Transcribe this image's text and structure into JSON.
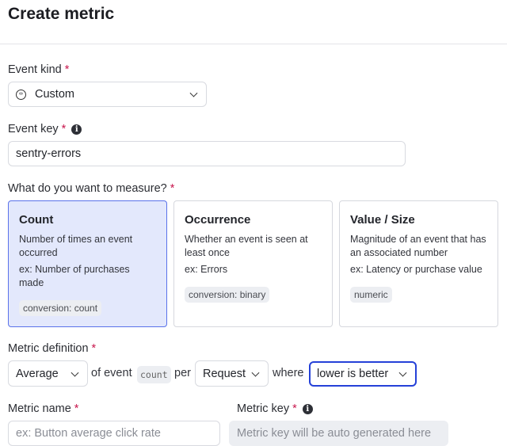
{
  "title": "Create metric",
  "event_kind": {
    "label": "Event kind",
    "value": "Custom",
    "icon": "code-circle-icon"
  },
  "event_key": {
    "label": "Event key",
    "value": "sentry-errors"
  },
  "measure": {
    "label": "What do you want to measure?",
    "options": [
      {
        "title": "Count",
        "desc": "Number of times an event occurred",
        "example": "ex: Number of purchases made",
        "tag": "conversion: count",
        "selected": true
      },
      {
        "title": "Occurrence",
        "desc": "Whether an event is seen at least once",
        "example": "ex: Errors",
        "tag": "conversion: binary",
        "selected": false
      },
      {
        "title": "Value / Size",
        "desc": "Magnitude of an event that has an associated number",
        "example": "ex: Latency or purchase value",
        "tag": "numeric",
        "selected": false
      }
    ]
  },
  "definition": {
    "label": "Metric definition",
    "aggregate": "Average",
    "of_event": "of event",
    "event_code": "count",
    "per": "per",
    "unit": "Request",
    "where": "where",
    "direction": "lower is better"
  },
  "metric_name": {
    "label": "Metric name",
    "placeholder": "ex: Button average click rate"
  },
  "metric_key": {
    "label": "Metric key",
    "placeholder": "Metric key will be auto generated here"
  },
  "required_mark": "*",
  "colors": {
    "accent": "#2541d8",
    "required": "#c8174d",
    "selected_bg": "#e3e8fc"
  }
}
